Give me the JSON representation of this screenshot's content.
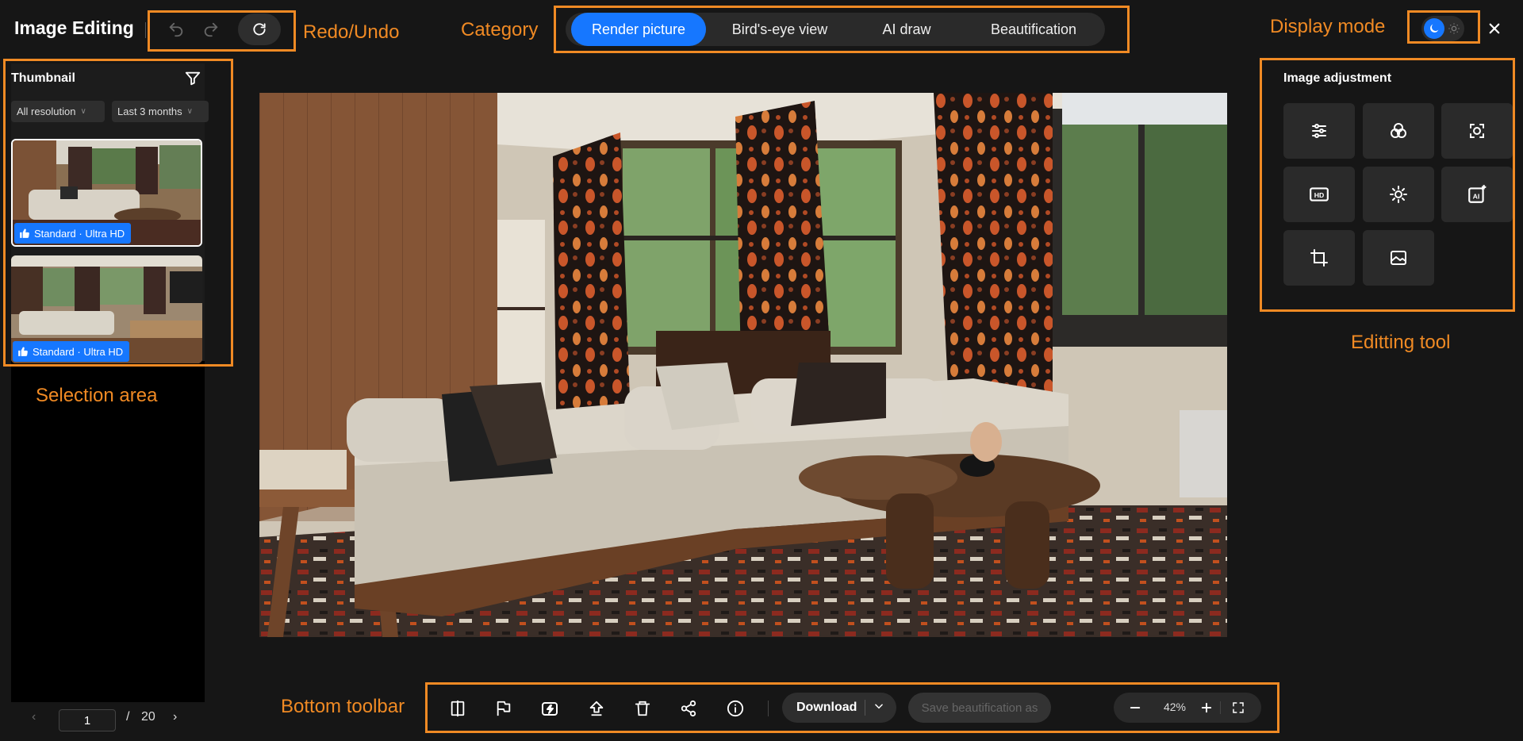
{
  "header": {
    "title": "Image Editing",
    "undo_icon": "undo-icon",
    "redo_icon": "redo-icon",
    "refresh_icon": "refresh-icon",
    "categories": [
      {
        "label": "Render picture",
        "active": true
      },
      {
        "label": "Bird's-eye view",
        "active": false
      },
      {
        "label": "AI draw",
        "active": false
      },
      {
        "label": "Beautification",
        "active": false
      }
    ],
    "display_mode": {
      "dark_icon": "moon-icon",
      "light_icon": "sun-icon",
      "current": "dark"
    },
    "close_icon": "close-icon"
  },
  "annotations": {
    "redo_undo": "Redo/Undo",
    "category": "Category",
    "display_mode": "Display mode",
    "editing_tool": "Editting tool",
    "selection_area": "Selection area",
    "bottom_toolbar": "Bottom toolbar",
    "color": "#f08a24"
  },
  "thumbnail_panel": {
    "title": "Thumbnail",
    "filter_icon": "filter-icon",
    "resolution_filter": "All resolution",
    "date_filter": "Last 3 months",
    "thumbnails": [
      {
        "badge": "Standard · Ultra HD",
        "selected": true
      },
      {
        "badge": "Standard · Ultra HD",
        "selected": false
      }
    ],
    "pagination": {
      "current": "1",
      "separator": "/",
      "total": "20"
    }
  },
  "image_adjustment": {
    "title": "Image adjustment",
    "tools": [
      "sliders-icon",
      "color-circles-icon",
      "smart-select-icon",
      "hd-icon",
      "brightness-icon",
      "ai-enhance-icon",
      "crop-icon",
      "landscape-icon"
    ]
  },
  "bottom_toolbar": {
    "icons": [
      "compare-icon",
      "flag-icon",
      "upscale-icon",
      "upload-icon",
      "delete-icon",
      "share-icon",
      "info-icon"
    ],
    "download_label": "Download",
    "save_label": "Save beautification as",
    "zoom": "42%"
  },
  "colors": {
    "accent": "#1677ff",
    "background": "#161616",
    "panel": "#2a2a2a"
  }
}
